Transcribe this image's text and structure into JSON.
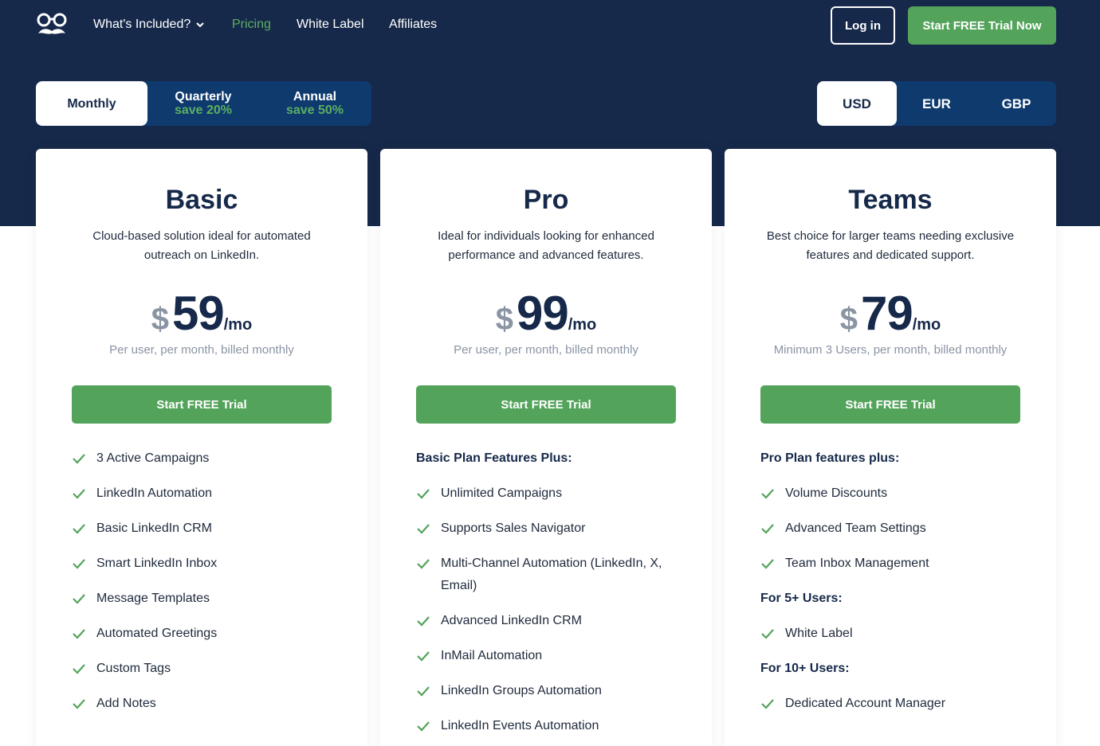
{
  "nav": {
    "logo_icon": "glasses-mustache-logo",
    "links": [
      {
        "label": "What's Included?",
        "has_dropdown": true
      },
      {
        "label": "Pricing",
        "active": true
      },
      {
        "label": "White Label"
      },
      {
        "label": "Affiliates"
      }
    ],
    "login_label": "Log in",
    "cta_label": "Start FREE Trial Now"
  },
  "billing": {
    "options": [
      {
        "label": "Monthly",
        "save": "",
        "selected": true
      },
      {
        "label": "Quarterly",
        "save": "save 20%"
      },
      {
        "label": "Annual",
        "save": "save 50%"
      }
    ]
  },
  "currency": {
    "options": [
      {
        "label": "USD",
        "selected": true
      },
      {
        "label": "EUR"
      },
      {
        "label": "GBP"
      }
    ]
  },
  "plans": [
    {
      "name": "Basic",
      "description": "Cloud-based solution ideal for automated outreach on LinkedIn.",
      "currency_symbol": "$",
      "price": "59",
      "per": "/mo",
      "note": "Per user, per month, billed monthly",
      "button": "Start FREE Trial",
      "features": [
        {
          "text": "3 Active Campaigns"
        },
        {
          "text": "LinkedIn Automation"
        },
        {
          "text": "Basic LinkedIn CRM"
        },
        {
          "text": "Smart LinkedIn Inbox"
        },
        {
          "text": "Message Templates"
        },
        {
          "text": "Automated Greetings"
        },
        {
          "text": "Custom Tags"
        },
        {
          "text": "Add Notes"
        }
      ]
    },
    {
      "name": "Pro",
      "description": "Ideal for individuals looking for enhanced performance and advanced features.",
      "currency_symbol": "$",
      "price": "99",
      "per": "/mo",
      "note": "Per user, per month, billed monthly",
      "button": "Start FREE Trial",
      "features": [
        {
          "heading": "Basic Plan Features Plus:"
        },
        {
          "text": "Unlimited Campaigns"
        },
        {
          "text": "Supports Sales Navigator"
        },
        {
          "text": "Multi-Channel Automation (LinkedIn, X, Email)"
        },
        {
          "text": "Advanced LinkedIn CRM"
        },
        {
          "text": "InMail Automation"
        },
        {
          "text": "LinkedIn Groups Automation"
        },
        {
          "text": "LinkedIn Events Automation"
        }
      ]
    },
    {
      "name": "Teams",
      "description": "Best choice for larger teams needing exclusive features and dedicated support.",
      "currency_symbol": "$",
      "price": "79",
      "per": "/mo",
      "note": "Minimum 3 Users, per month, billed monthly",
      "button": "Start FREE Trial",
      "features": [
        {
          "heading": "Pro Plan features plus:"
        },
        {
          "text": "Volume Discounts"
        },
        {
          "text": "Advanced Team Settings"
        },
        {
          "text": "Team Inbox Management"
        },
        {
          "heading": "For 5+ Users:"
        },
        {
          "text": "White Label"
        },
        {
          "heading": "For 10+ Users:"
        },
        {
          "text": "Dedicated Account Manager"
        }
      ]
    }
  ],
  "colors": {
    "navy": "#16294a",
    "green": "#53a35a",
    "toggle_bg": "#0e3a6e",
    "muted": "#8a94a3"
  }
}
